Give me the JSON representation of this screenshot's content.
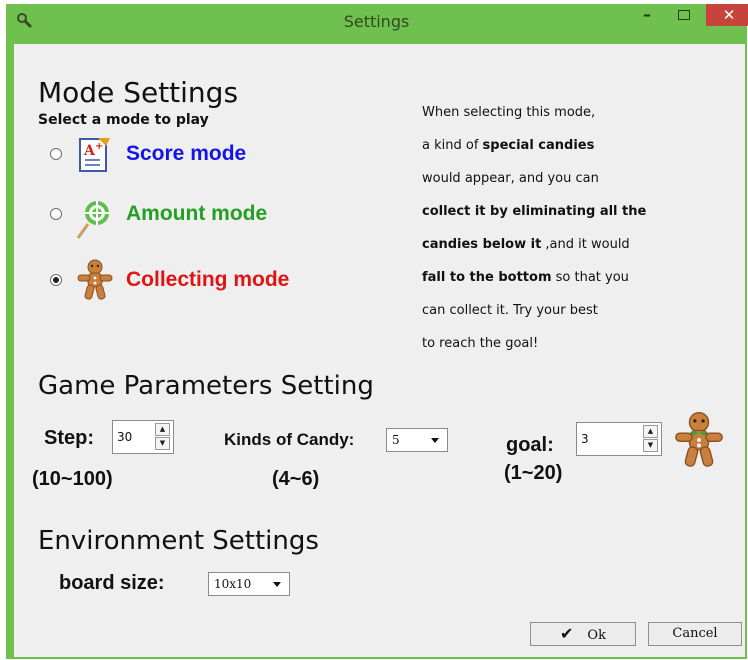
{
  "window": {
    "title": "Settings",
    "minimize_glyph": "–",
    "close_glyph": "✕"
  },
  "mode_section": {
    "heading": "Mode Settings",
    "subheading": "Select a mode to play",
    "modes": [
      {
        "label": "Score mode",
        "color": "#1414e6",
        "icon": "report-card-icon",
        "selected": false
      },
      {
        "label": "Amount mode",
        "color": "#22a022",
        "icon": "lollipop-icon",
        "selected": false
      },
      {
        "label": "Collecting mode",
        "color": "#e01414",
        "icon": "gingerbread-man-icon",
        "selected": true
      }
    ],
    "description": {
      "l1": "When selecting this mode,",
      "l2a": "a kind of ",
      "l2b": "special candies",
      "l3": "would appear, and you can",
      "l4": "collect it by eliminating all the",
      "l5a": "candies below it",
      "l5b": " ,and it would",
      "l6a": "fall to the bottom",
      "l6b": " so that you",
      "l7": "can collect it. Try your best",
      "l8": "to reach the goal!"
    }
  },
  "params_section": {
    "heading": "Game Parameters Setting",
    "step": {
      "label": "Step:",
      "value": "30",
      "range": "(10~100)"
    },
    "kinds": {
      "label": "Kinds of Candy:",
      "value": "5",
      "range": "(4~6)"
    },
    "goal": {
      "label": "goal:",
      "value": "3",
      "range": "(1~20)",
      "icon": "gingerbread-man-icon"
    }
  },
  "env_section": {
    "heading": "Environment Settings",
    "board_size_label": "board size:",
    "board_size_value": "10x10"
  },
  "buttons": {
    "ok": "Ok",
    "cancel": "Cancel"
  }
}
